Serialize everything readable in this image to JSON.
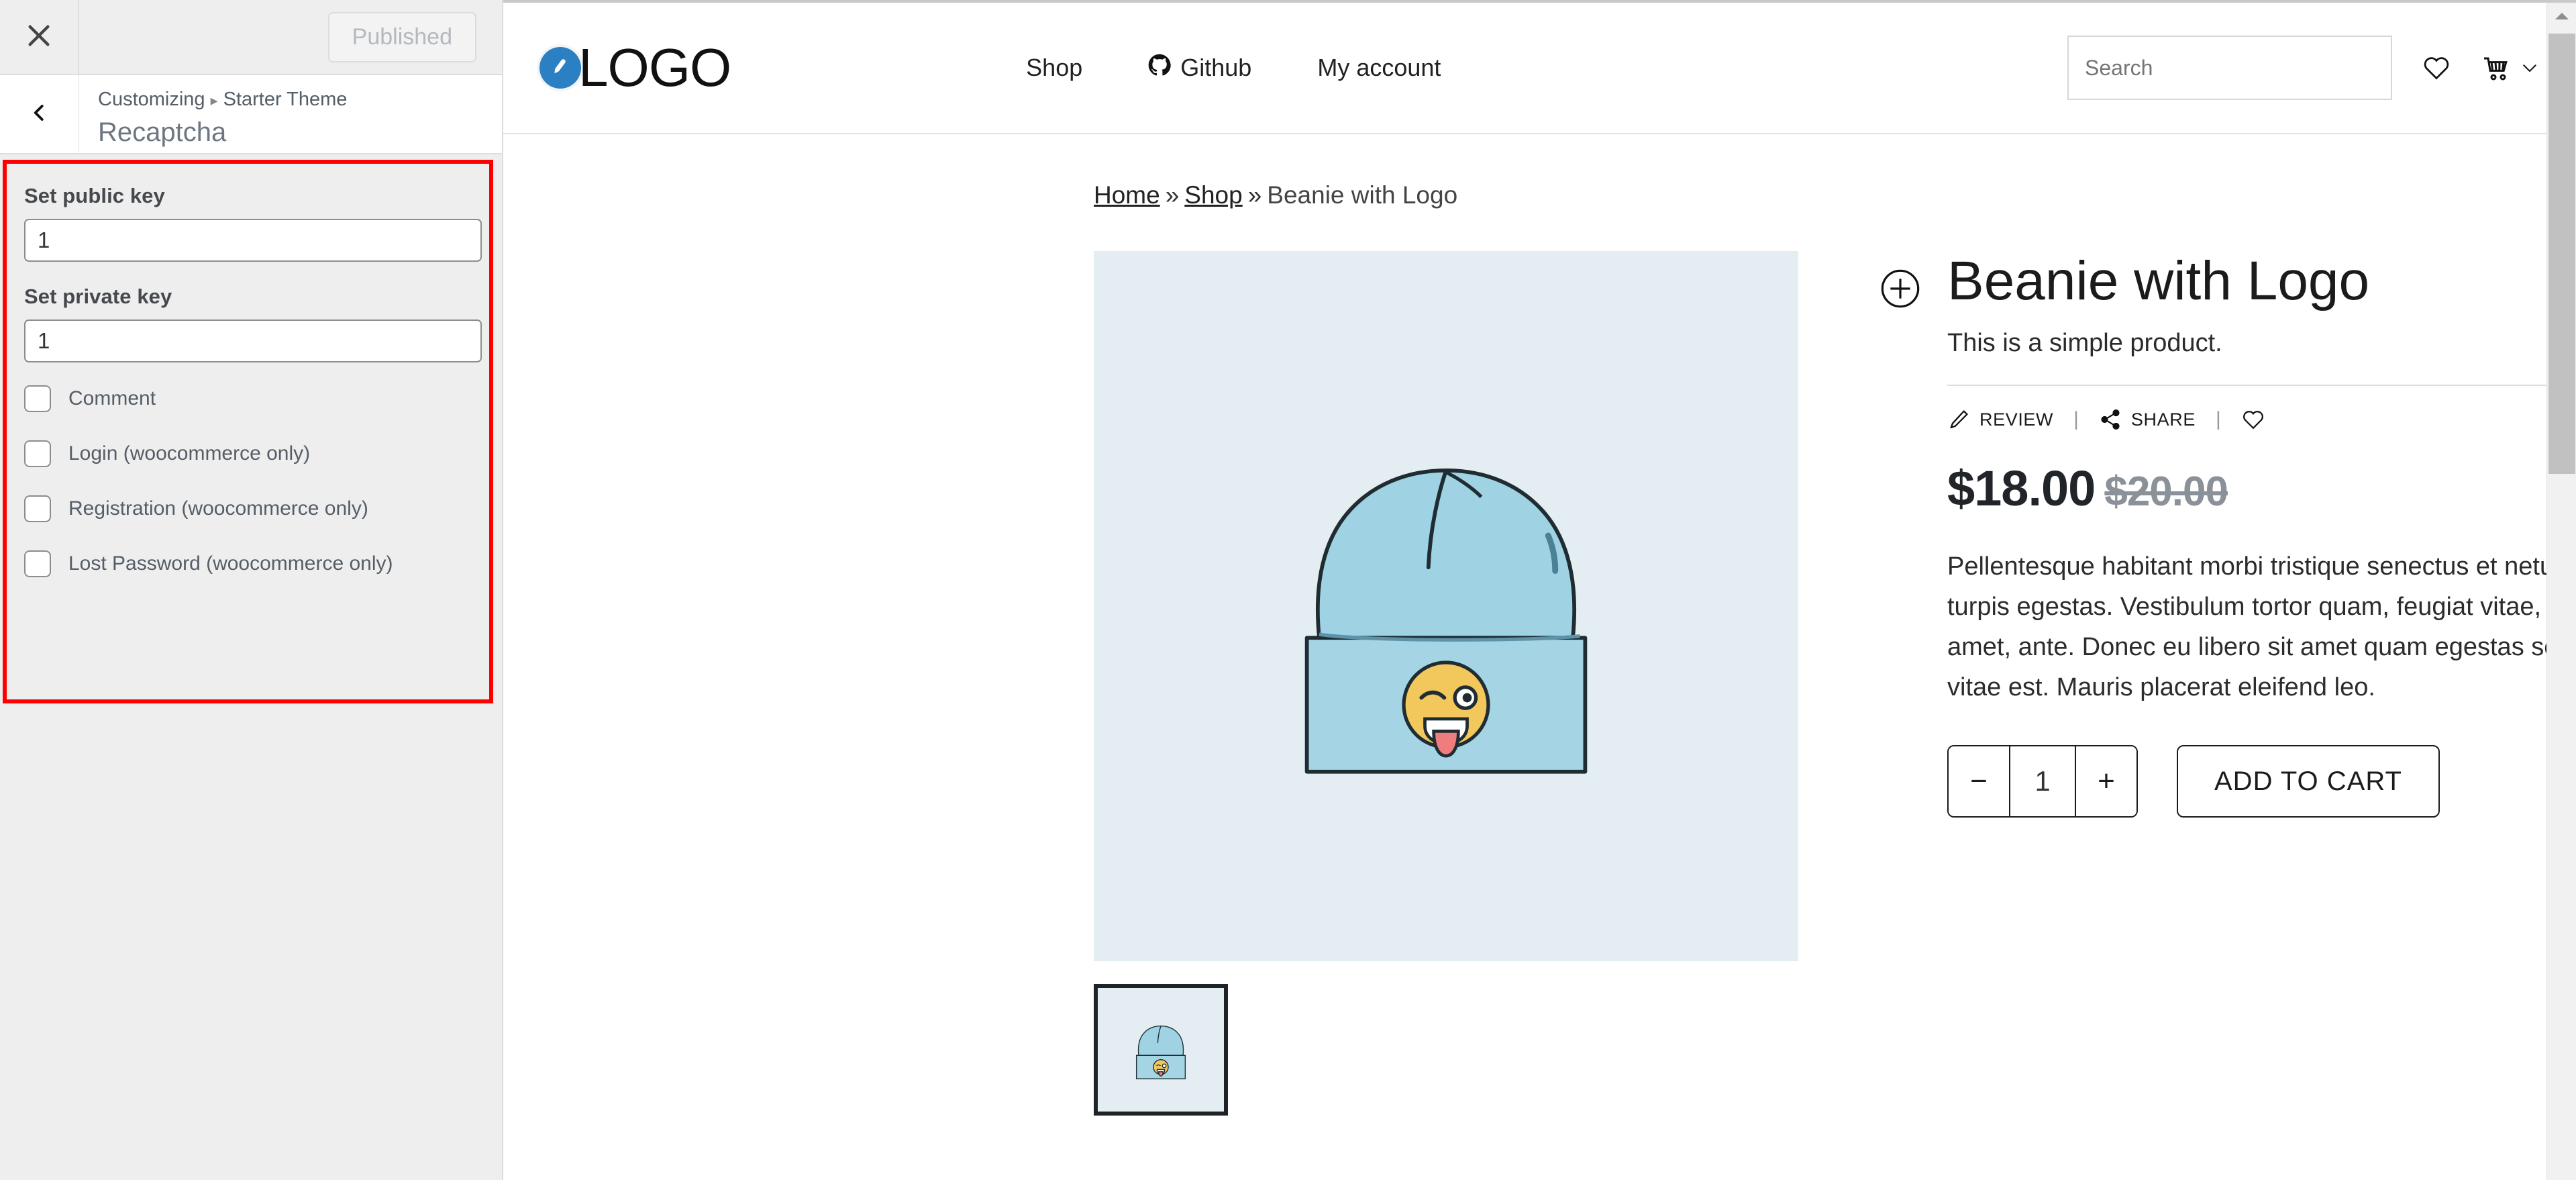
{
  "customizer": {
    "close_icon": "close-icon",
    "published_label": "Published",
    "back_icon": "chevron-left-icon",
    "breadcrumb": {
      "root": "Customizing",
      "separator": "▸",
      "theme": "Starter Theme"
    },
    "section_title": "Recaptcha",
    "settings": {
      "public_key": {
        "label": "Set public key",
        "value": "1"
      },
      "private_key": {
        "label": "Set private key",
        "value": "1"
      },
      "checkboxes": [
        {
          "label": "Comment",
          "checked": false
        },
        {
          "label": "Login (woocommerce only)",
          "checked": false
        },
        {
          "label": "Registration (woocommerce only)",
          "checked": false
        },
        {
          "label": "Lost Password (woocommerce only)",
          "checked": false
        }
      ]
    },
    "highlight_color": "#ff0000"
  },
  "site": {
    "logo": {
      "text": "LOGO",
      "mark_icon": "pencil-circle-icon",
      "mark_color": "#2b80c4"
    },
    "nav": [
      {
        "label": "Shop",
        "icon": null
      },
      {
        "label": "Github",
        "icon": "github-icon"
      },
      {
        "label": "My account",
        "icon": null
      }
    ],
    "search": {
      "placeholder": "Search",
      "value": ""
    },
    "wishlist_icon": "heart-icon",
    "cart_icon": "cart-icon",
    "cart_chevron_icon": "chevron-down-icon"
  },
  "breadcrumb": {
    "items": [
      {
        "label": "Home",
        "link": true
      },
      {
        "label": "Shop",
        "link": true
      },
      {
        "label": "Beanie with Logo",
        "link": false
      }
    ],
    "separator": "»"
  },
  "product": {
    "zoom_icon": "plus-circle-icon",
    "title": "Beanie with Logo",
    "short_description": "This is a simple product.",
    "actions": [
      {
        "label": "REVIEW",
        "icon": "pencil-icon"
      },
      {
        "label": "SHARE",
        "icon": "share-icon"
      }
    ],
    "action_separator": "|",
    "wishlist_icon": "heart-icon",
    "price": {
      "current": "$18.00",
      "original": "$20.00"
    },
    "description": "Pellentesque habitant morbi tristique senectus et netus et malesuada fames ac turpis egestas. Vestibulum tortor quam, feugiat vitae, ultricies eget, tempor sit amet, ante. Donec eu libero sit amet quam egestas semper. Aenean ultricies mi vitae est. Mauris placerat eleifend leo.",
    "quantity": {
      "value": "1",
      "decrease": "−",
      "increase": "+"
    },
    "add_to_cart_label": "ADD TO CART",
    "image_bg": "#e4edf2",
    "thumbnail_count": 1
  },
  "scrollbar": {
    "up_icon": "triangle-up-icon"
  }
}
